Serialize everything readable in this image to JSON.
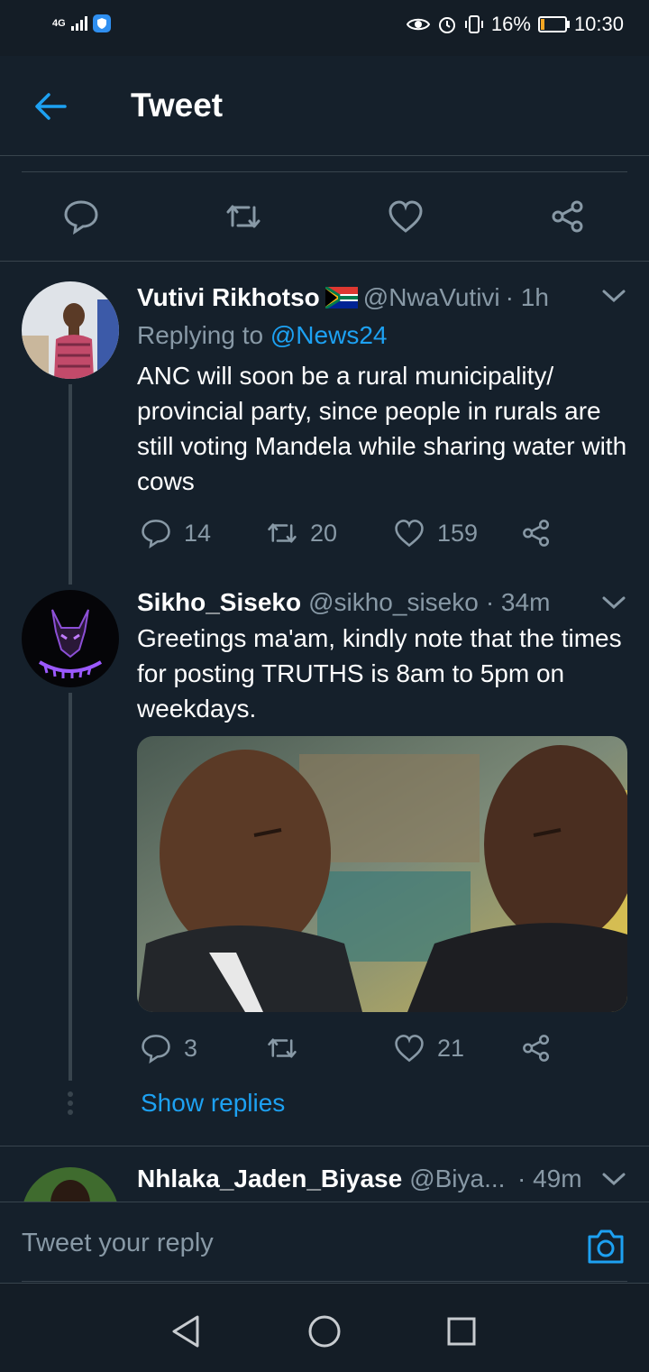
{
  "status_bar": {
    "network": "4G",
    "battery": "16%",
    "time": "10:30",
    "icons": [
      "signal-icon",
      "shield-icon",
      "eye-icon",
      "alarm-icon",
      "vibrate-icon",
      "battery-icon"
    ]
  },
  "header": {
    "title": "Tweet"
  },
  "tweets": [
    {
      "name": "Vutivi Rikhotso",
      "flag": "south-africa-flag-icon",
      "handle": "@NwaVutivi",
      "time": "· 1h",
      "replying_to_label": "Replying to",
      "replying_to_handle": "@News24",
      "text": "ANC will soon be a rural municipality/ provincial party, since people in rurals are still voting Mandela while sharing water with cows",
      "replies": "14",
      "retweets": "20",
      "likes": "159"
    },
    {
      "name": "Sikho_Siseko",
      "handle": "@sikho_siseko",
      "time": "· 34m",
      "text": "Greetings ma'am, kindly note that the times for posting TRUTHS is 8am to 5pm on weekdays.",
      "replies": "3",
      "retweets": "",
      "likes": "21",
      "show_replies": "Show replies"
    },
    {
      "name": "Nhlaka_Jaden_Biyase",
      "handle": "@Biya...",
      "time": "· 49m"
    }
  ],
  "reply": {
    "placeholder": "Tweet your reply"
  },
  "colors": {
    "background": "#15202b",
    "accent": "#1da1f2",
    "muted": "#8899a6",
    "divider": "#38444d"
  }
}
